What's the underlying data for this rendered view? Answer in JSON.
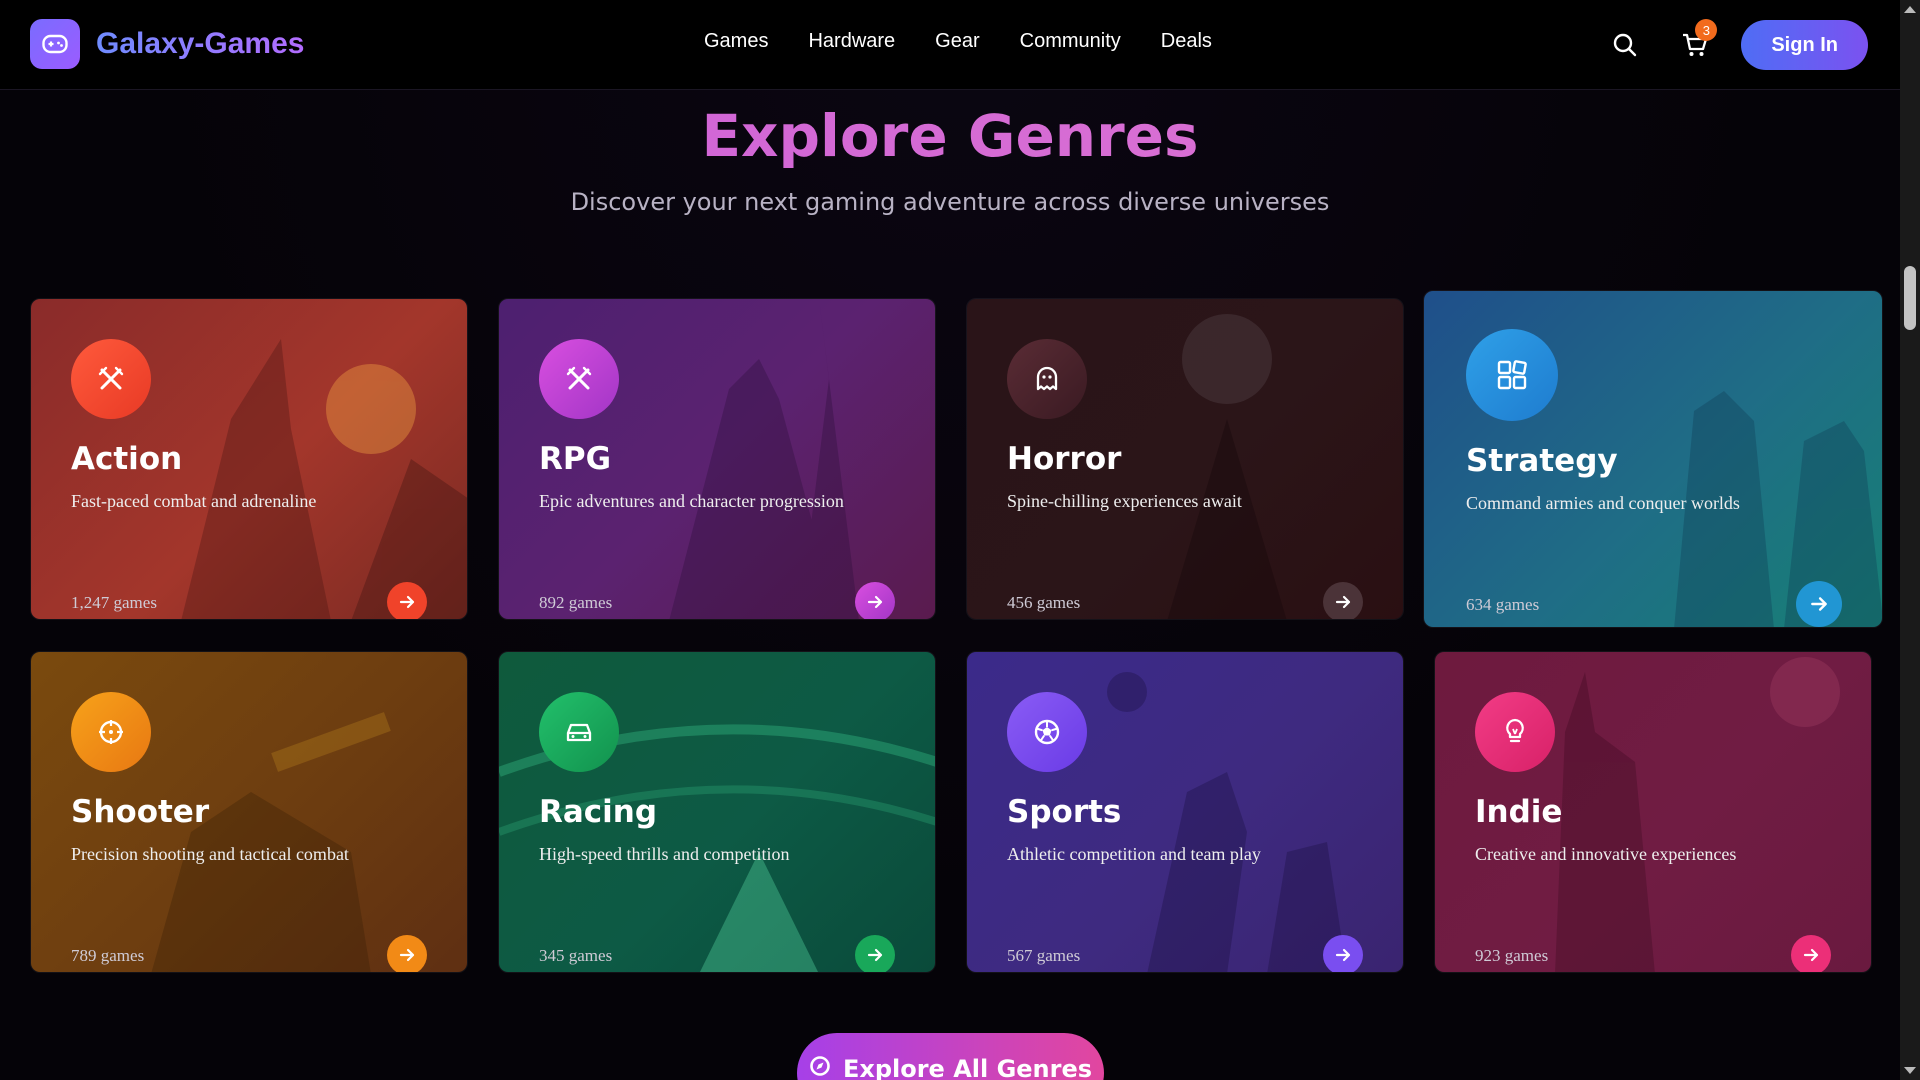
{
  "header": {
    "brand": "Galaxy-Games",
    "nav": [
      "Games",
      "Hardware",
      "Gear",
      "Community",
      "Deals"
    ],
    "cart_count": "3",
    "sign_in": "Sign In"
  },
  "hero": {
    "title": "Explore Genres",
    "subtitle": "Discover your next gaming adventure across diverse universes"
  },
  "genres": [
    {
      "name": "Action",
      "desc": "Fast-paced combat and adrenaline",
      "count": "1,247 games",
      "icon": "swords-icon",
      "color": "#f0432a"
    },
    {
      "name": "RPG",
      "desc": "Epic adventures and character progression",
      "count": "892 games",
      "icon": "swords-icon",
      "color": "#c73fd6"
    },
    {
      "name": "Horror",
      "desc": "Spine-chilling experiences await",
      "count": "456 games",
      "icon": "ghost-icon",
      "color": "#4a2b33"
    },
    {
      "name": "Strategy",
      "desc": "Command armies and conquer worlds",
      "count": "634 games",
      "icon": "grid-icon",
      "color": "#2196d3"
    },
    {
      "name": "Shooter",
      "desc": "Precision shooting and tactical combat",
      "count": "789 games",
      "icon": "crosshair-icon",
      "color": "#f28a16"
    },
    {
      "name": "Racing",
      "desc": "High-speed thrills and competition",
      "count": "345 games",
      "icon": "car-icon",
      "color": "#19a85a"
    },
    {
      "name": "Sports",
      "desc": "Athletic competition and team play",
      "count": "567 games",
      "icon": "soccer-ball-icon",
      "color": "#7a4ef0"
    },
    {
      "name": "Indie",
      "desc": "Creative and innovative experiences",
      "count": "923 games",
      "icon": "lightbulb-icon",
      "color": "#ec2f78"
    }
  ],
  "explore_all": "Explore All Genres"
}
